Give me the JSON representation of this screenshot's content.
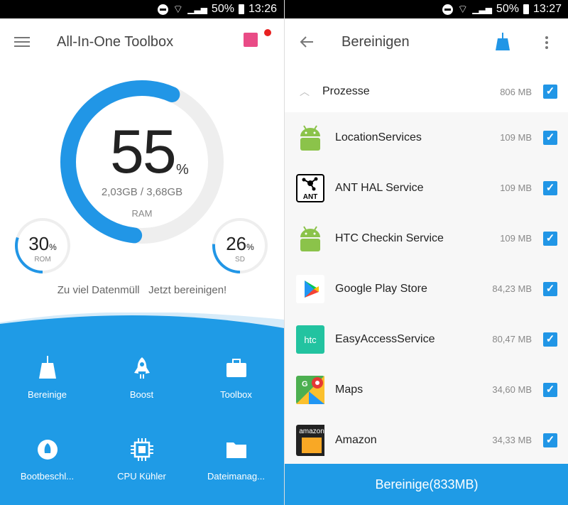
{
  "left": {
    "status": {
      "battery": "50%",
      "time": "13:26"
    },
    "header": {
      "title": "All-In-One Toolbox",
      "menu_icon": "hamburger-icon",
      "gift_icon": "gift-icon"
    },
    "ram": {
      "percent": 55,
      "percent_text": "55",
      "percent_sign": "%",
      "usage": "2,03GB / 3,68GB",
      "label": "RAM"
    },
    "rom": {
      "percent": 30,
      "value": "30",
      "sign": "%",
      "label": "ROM"
    },
    "sd": {
      "percent": 26,
      "value": "26",
      "sign": "%",
      "label": "SD"
    },
    "message": "Zu viel Datenmüll   Jetzt bereinigen!",
    "tools": [
      {
        "label": "Bereinige",
        "icon": "broom-icon"
      },
      {
        "label": "Boost",
        "icon": "rocket-icon"
      },
      {
        "label": "Toolbox",
        "icon": "briefcase-icon"
      },
      {
        "label": "Bootbeschl...",
        "icon": "boot-icon"
      },
      {
        "label": "CPU Kühler",
        "icon": "cpu-icon"
      },
      {
        "label": "Dateimanag...",
        "icon": "folder-icon"
      }
    ],
    "colors": {
      "accent": "#1f9be6",
      "gift": "#e94b86"
    }
  },
  "right": {
    "status": {
      "battery": "50%",
      "time": "13:27"
    },
    "header": {
      "title": "Bereinigen"
    },
    "group": {
      "label": "Prozesse",
      "size": "806 MB",
      "checked": true
    },
    "apps": [
      {
        "name": "LocationServices",
        "size": "109 MB",
        "checked": true,
        "icon": "android-icon"
      },
      {
        "name": "ANT HAL Service",
        "size": "109 MB",
        "checked": true,
        "icon": "ant-icon",
        "icon_text": "ANT"
      },
      {
        "name": "HTC Checkin Service",
        "size": "109 MB",
        "checked": true,
        "icon": "android-icon"
      },
      {
        "name": "Google Play Store",
        "size": "84,23 MB",
        "checked": true,
        "icon": "play-store-icon"
      },
      {
        "name": "EasyAccessService",
        "size": "80,47 MB",
        "checked": true,
        "icon": "htc-icon",
        "icon_text": "htc"
      },
      {
        "name": "Maps",
        "size": "34,60 MB",
        "checked": true,
        "icon": "maps-icon"
      },
      {
        "name": "Amazon",
        "size": "34,33 MB",
        "checked": true,
        "icon": "amazon-icon",
        "icon_text": "amazon"
      }
    ],
    "button": "Bereinige(833MB)"
  }
}
